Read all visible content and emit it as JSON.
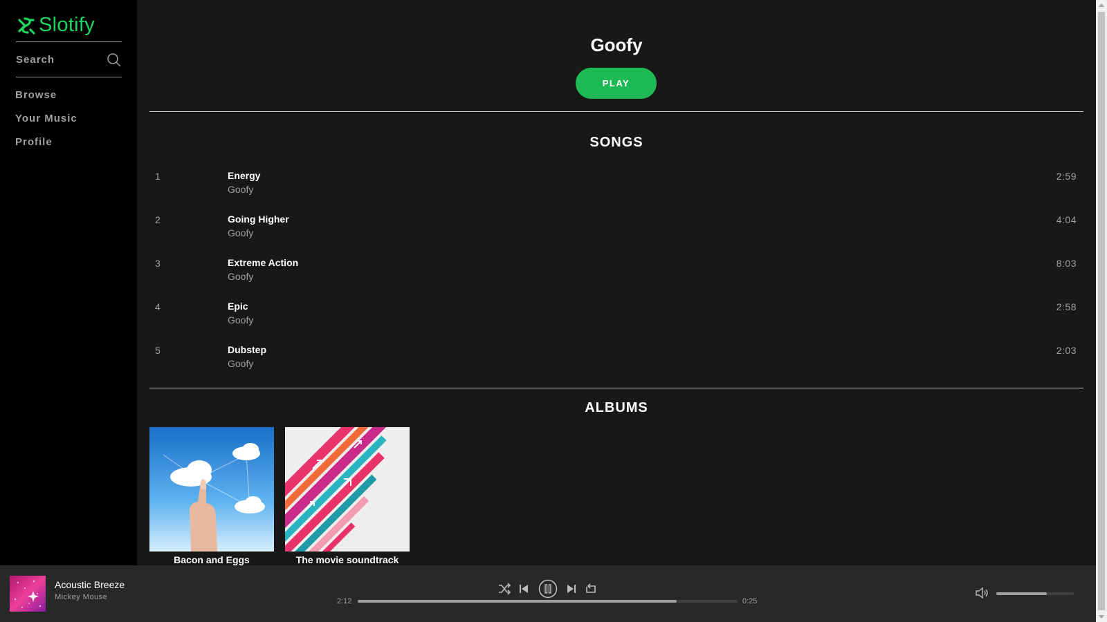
{
  "app": {
    "name": "Slotify",
    "accent_color": "#1db954"
  },
  "sidebar": {
    "search_label": "Search",
    "nav": [
      "Browse",
      "Your Music",
      "Profile"
    ]
  },
  "artist": {
    "name": "Goofy",
    "play_label": "PLAY"
  },
  "songs": {
    "title": "SONGS",
    "tracks": [
      {
        "num": "1",
        "title": "Energy",
        "artist": "Goofy",
        "duration": "2:59"
      },
      {
        "num": "2",
        "title": "Going Higher",
        "artist": "Goofy",
        "duration": "4:04"
      },
      {
        "num": "3",
        "title": "Extreme Action",
        "artist": "Goofy",
        "duration": "8:03"
      },
      {
        "num": "4",
        "title": "Epic",
        "artist": "Goofy",
        "duration": "2:58"
      },
      {
        "num": "5",
        "title": "Dubstep",
        "artist": "Goofy",
        "duration": "2:03"
      }
    ]
  },
  "albums": {
    "title": "ALBUMS",
    "items": [
      {
        "title": "Bacon and Eggs"
      },
      {
        "title": "The movie soundtrack"
      }
    ]
  },
  "player": {
    "now_playing_title": "Acoustic Breeze",
    "now_playing_artist": "Mickey Mouse",
    "time_current": "2:12",
    "time_remaining": "0:25",
    "progress": 0.84,
    "volume": 0.65,
    "icons": [
      "shuffle-icon",
      "previous-icon",
      "pause-icon",
      "next-icon",
      "repeat-icon",
      "volume-icon"
    ]
  }
}
